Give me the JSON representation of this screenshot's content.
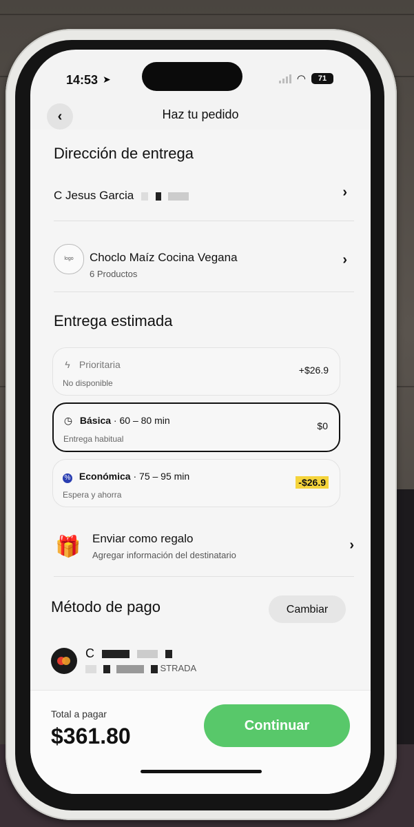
{
  "status": {
    "time": "14:53",
    "battery": "71"
  },
  "header": {
    "title": "Haz tu pedido"
  },
  "delivery": {
    "section_title": "Dirección de entrega",
    "address": "C Jesus Garcia"
  },
  "store": {
    "name": "Choclo Maíz Cocina Vegana",
    "products": "6 Productos"
  },
  "eta": {
    "section_title": "Entrega estimada",
    "options": [
      {
        "title": "Prioritaria",
        "time": "",
        "subtitle": "No disponible",
        "price": "+$26.9"
      },
      {
        "title": "Básica",
        "time": " · 60 – 80 min",
        "subtitle": "Entrega habitual",
        "price": "$0"
      },
      {
        "title": "Económica",
        "time": " · 75 – 95 min",
        "subtitle": "Espera y ahorra",
        "price": "-$26.9"
      }
    ]
  },
  "gift": {
    "title": "Enviar como regalo",
    "subtitle": "Agregar información del destinatario"
  },
  "payment": {
    "section_title": "Método de pago",
    "change_label": "Cambiar",
    "card_line1": "C",
    "card_line2_suffix": "STRADA"
  },
  "footer": {
    "total_label": "Total a pagar",
    "total_amount": "$361.80",
    "continue_label": "Continuar"
  }
}
